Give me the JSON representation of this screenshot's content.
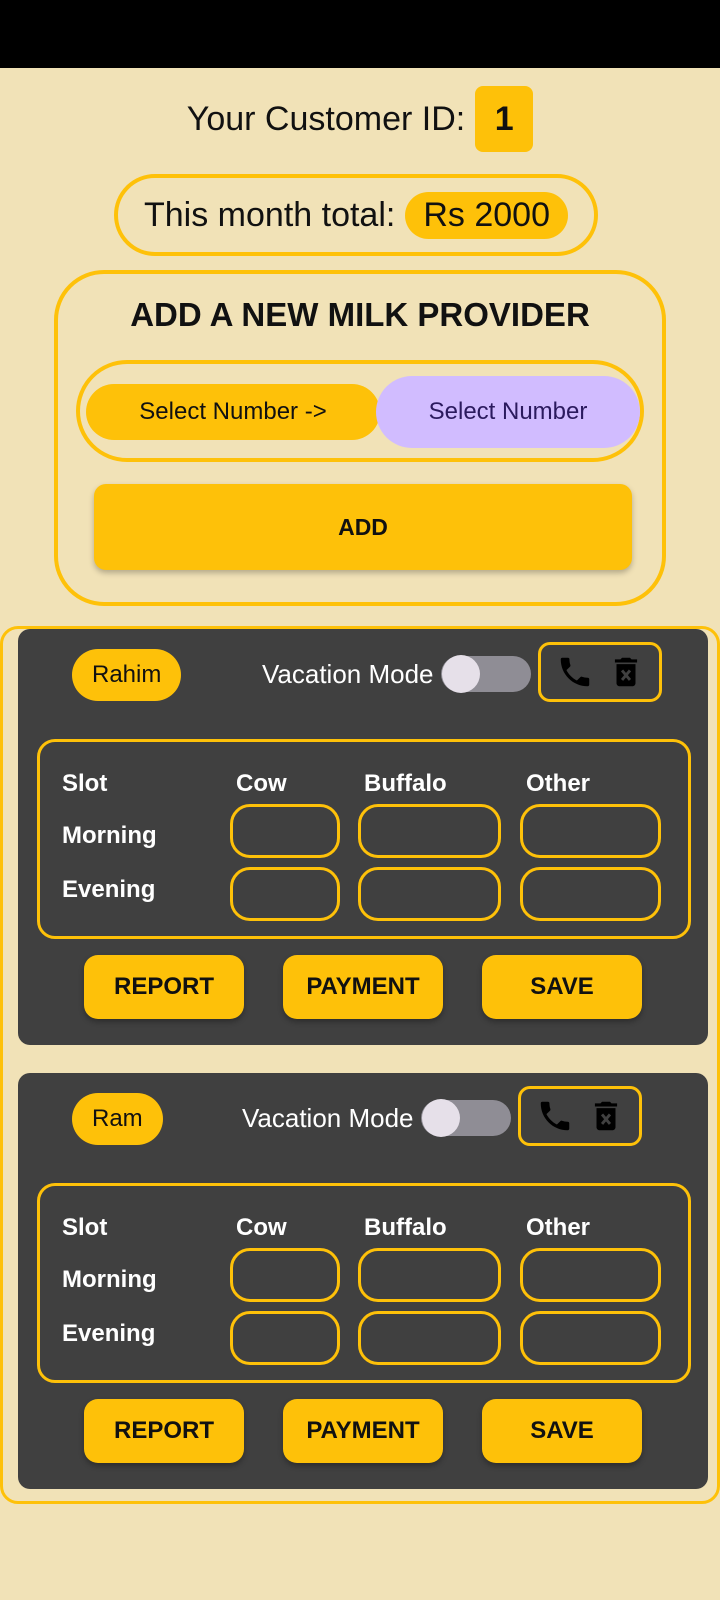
{
  "customer": {
    "label": "Your Customer ID:",
    "id": "1"
  },
  "month": {
    "label": "This month total:",
    "value": "Rs 2000"
  },
  "add_provider": {
    "title": "ADD A NEW MILK PROVIDER",
    "select_prompt": "Select Number ->",
    "select_button": "Select Number",
    "add_button": "ADD"
  },
  "providers": [
    {
      "name": "Rahim",
      "vacation_label": "Vacation Mode",
      "vacation_on": false,
      "table": {
        "slot": "Slot",
        "cow": "Cow",
        "buffalo": "Buffalo",
        "other": "Other",
        "morning": "Morning",
        "evening": "Evening"
      },
      "buttons": {
        "report": "REPORT",
        "payment": "PAYMENT",
        "save": "SAVE"
      }
    },
    {
      "name": "Ram",
      "vacation_label": "Vacation Mode",
      "vacation_on": false,
      "table": {
        "slot": "Slot",
        "cow": "Cow",
        "buffalo": "Buffalo",
        "other": "Other",
        "morning": "Morning",
        "evening": "Evening"
      },
      "buttons": {
        "report": "REPORT",
        "payment": "PAYMENT",
        "save": "SAVE"
      }
    }
  ],
  "icons": {
    "call": "phone-icon",
    "delete": "delete-icon"
  },
  "colors": {
    "accent": "#fec109",
    "background": "#f1e2b7",
    "card": "#404040",
    "select_button": "#d1bcff"
  }
}
